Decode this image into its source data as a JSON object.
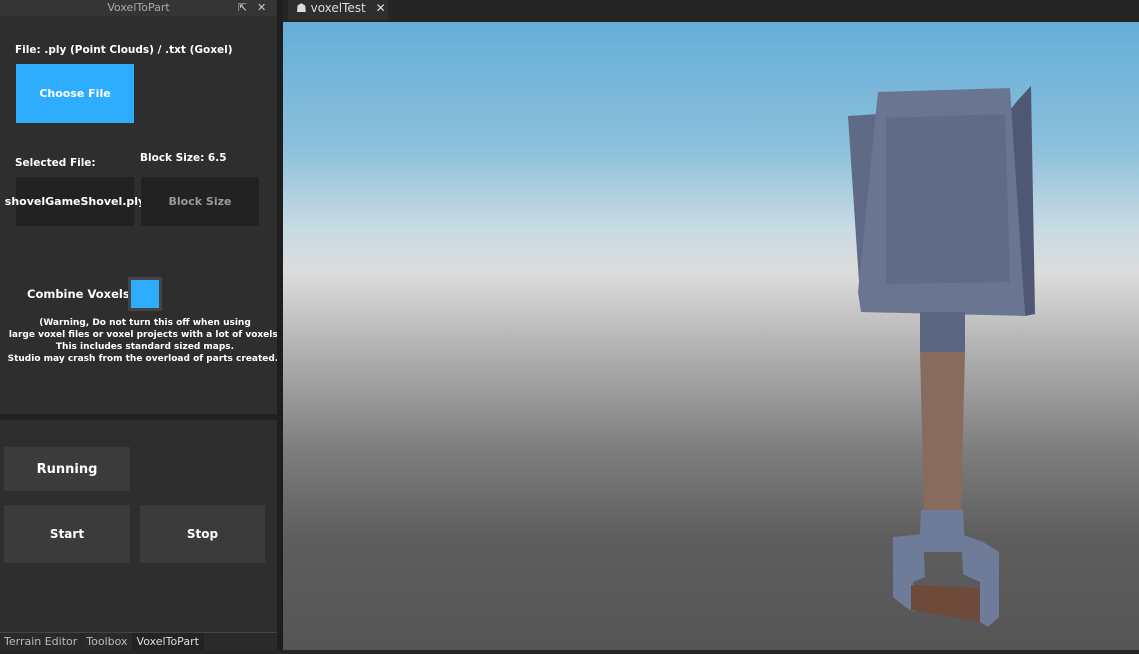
{
  "panel": {
    "title": "VoxelToPart",
    "file_label": "File: .ply (Point Clouds) / .txt (Goxel)",
    "choose_file": "Choose File",
    "selected_file_label": "Selected File:",
    "selected_file": "shovelGameShovel.ply",
    "block_size_label": "Block Size: 6.5",
    "block_size_placeholder": "Block Size",
    "combine_label": "Combine Voxels:",
    "warning": [
      "(Warning, Do not turn this off when using",
      "large voxel files or voxel projects with a lot of voxels.",
      "This includes standard sized maps.",
      "Studio may crash from the overload of parts created.)"
    ],
    "status": "Running",
    "start": "Start",
    "stop": "Stop"
  },
  "bottom_tabs": [
    "Terrain Editor",
    "Toolbox",
    "VoxelToPart"
  ],
  "doc_tab": "voxelTest",
  "colors": {
    "accent": "#2eadff"
  }
}
